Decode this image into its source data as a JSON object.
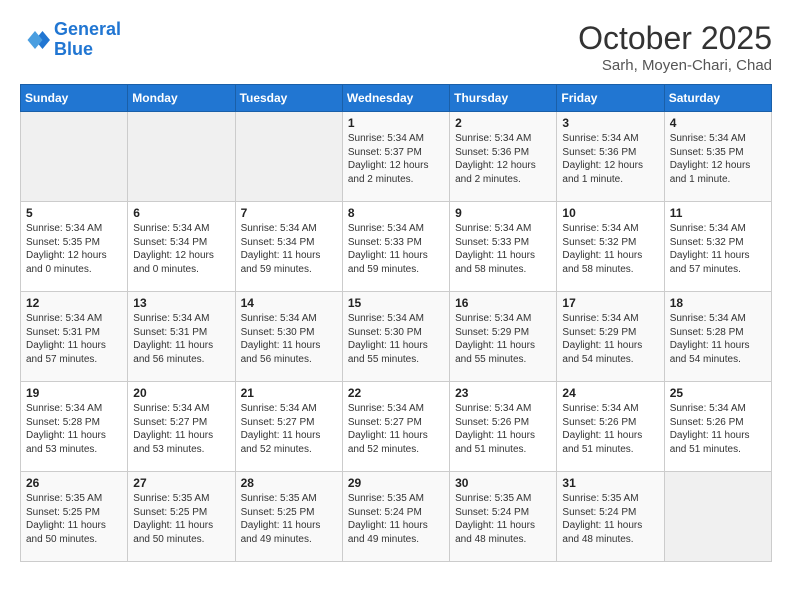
{
  "header": {
    "logo_line1": "General",
    "logo_line2": "Blue",
    "month": "October 2025",
    "location": "Sarh, Moyen-Chari, Chad"
  },
  "weekdays": [
    "Sunday",
    "Monday",
    "Tuesday",
    "Wednesday",
    "Thursday",
    "Friday",
    "Saturday"
  ],
  "weeks": [
    [
      {
        "day": "",
        "sunrise": "",
        "sunset": "",
        "daylight": "",
        "empty": true
      },
      {
        "day": "",
        "sunrise": "",
        "sunset": "",
        "daylight": "",
        "empty": true
      },
      {
        "day": "",
        "sunrise": "",
        "sunset": "",
        "daylight": "",
        "empty": true
      },
      {
        "day": "1",
        "sunrise": "Sunrise: 5:34 AM",
        "sunset": "Sunset: 5:37 PM",
        "daylight": "Daylight: 12 hours and 2 minutes."
      },
      {
        "day": "2",
        "sunrise": "Sunrise: 5:34 AM",
        "sunset": "Sunset: 5:36 PM",
        "daylight": "Daylight: 12 hours and 2 minutes."
      },
      {
        "day": "3",
        "sunrise": "Sunrise: 5:34 AM",
        "sunset": "Sunset: 5:36 PM",
        "daylight": "Daylight: 12 hours and 1 minute."
      },
      {
        "day": "4",
        "sunrise": "Sunrise: 5:34 AM",
        "sunset": "Sunset: 5:35 PM",
        "daylight": "Daylight: 12 hours and 1 minute."
      }
    ],
    [
      {
        "day": "5",
        "sunrise": "Sunrise: 5:34 AM",
        "sunset": "Sunset: 5:35 PM",
        "daylight": "Daylight: 12 hours and 0 minutes."
      },
      {
        "day": "6",
        "sunrise": "Sunrise: 5:34 AM",
        "sunset": "Sunset: 5:34 PM",
        "daylight": "Daylight: 12 hours and 0 minutes."
      },
      {
        "day": "7",
        "sunrise": "Sunrise: 5:34 AM",
        "sunset": "Sunset: 5:34 PM",
        "daylight": "Daylight: 11 hours and 59 minutes."
      },
      {
        "day": "8",
        "sunrise": "Sunrise: 5:34 AM",
        "sunset": "Sunset: 5:33 PM",
        "daylight": "Daylight: 11 hours and 59 minutes."
      },
      {
        "day": "9",
        "sunrise": "Sunrise: 5:34 AM",
        "sunset": "Sunset: 5:33 PM",
        "daylight": "Daylight: 11 hours and 58 minutes."
      },
      {
        "day": "10",
        "sunrise": "Sunrise: 5:34 AM",
        "sunset": "Sunset: 5:32 PM",
        "daylight": "Daylight: 11 hours and 58 minutes."
      },
      {
        "day": "11",
        "sunrise": "Sunrise: 5:34 AM",
        "sunset": "Sunset: 5:32 PM",
        "daylight": "Daylight: 11 hours and 57 minutes."
      }
    ],
    [
      {
        "day": "12",
        "sunrise": "Sunrise: 5:34 AM",
        "sunset": "Sunset: 5:31 PM",
        "daylight": "Daylight: 11 hours and 57 minutes."
      },
      {
        "day": "13",
        "sunrise": "Sunrise: 5:34 AM",
        "sunset": "Sunset: 5:31 PM",
        "daylight": "Daylight: 11 hours and 56 minutes."
      },
      {
        "day": "14",
        "sunrise": "Sunrise: 5:34 AM",
        "sunset": "Sunset: 5:30 PM",
        "daylight": "Daylight: 11 hours and 56 minutes."
      },
      {
        "day": "15",
        "sunrise": "Sunrise: 5:34 AM",
        "sunset": "Sunset: 5:30 PM",
        "daylight": "Daylight: 11 hours and 55 minutes."
      },
      {
        "day": "16",
        "sunrise": "Sunrise: 5:34 AM",
        "sunset": "Sunset: 5:29 PM",
        "daylight": "Daylight: 11 hours and 55 minutes."
      },
      {
        "day": "17",
        "sunrise": "Sunrise: 5:34 AM",
        "sunset": "Sunset: 5:29 PM",
        "daylight": "Daylight: 11 hours and 54 minutes."
      },
      {
        "day": "18",
        "sunrise": "Sunrise: 5:34 AM",
        "sunset": "Sunset: 5:28 PM",
        "daylight": "Daylight: 11 hours and 54 minutes."
      }
    ],
    [
      {
        "day": "19",
        "sunrise": "Sunrise: 5:34 AM",
        "sunset": "Sunset: 5:28 PM",
        "daylight": "Daylight: 11 hours and 53 minutes."
      },
      {
        "day": "20",
        "sunrise": "Sunrise: 5:34 AM",
        "sunset": "Sunset: 5:27 PM",
        "daylight": "Daylight: 11 hours and 53 minutes."
      },
      {
        "day": "21",
        "sunrise": "Sunrise: 5:34 AM",
        "sunset": "Sunset: 5:27 PM",
        "daylight": "Daylight: 11 hours and 52 minutes."
      },
      {
        "day": "22",
        "sunrise": "Sunrise: 5:34 AM",
        "sunset": "Sunset: 5:27 PM",
        "daylight": "Daylight: 11 hours and 52 minutes."
      },
      {
        "day": "23",
        "sunrise": "Sunrise: 5:34 AM",
        "sunset": "Sunset: 5:26 PM",
        "daylight": "Daylight: 11 hours and 51 minutes."
      },
      {
        "day": "24",
        "sunrise": "Sunrise: 5:34 AM",
        "sunset": "Sunset: 5:26 PM",
        "daylight": "Daylight: 11 hours and 51 minutes."
      },
      {
        "day": "25",
        "sunrise": "Sunrise: 5:34 AM",
        "sunset": "Sunset: 5:26 PM",
        "daylight": "Daylight: 11 hours and 51 minutes."
      }
    ],
    [
      {
        "day": "26",
        "sunrise": "Sunrise: 5:35 AM",
        "sunset": "Sunset: 5:25 PM",
        "daylight": "Daylight: 11 hours and 50 minutes."
      },
      {
        "day": "27",
        "sunrise": "Sunrise: 5:35 AM",
        "sunset": "Sunset: 5:25 PM",
        "daylight": "Daylight: 11 hours and 50 minutes."
      },
      {
        "day": "28",
        "sunrise": "Sunrise: 5:35 AM",
        "sunset": "Sunset: 5:25 PM",
        "daylight": "Daylight: 11 hours and 49 minutes."
      },
      {
        "day": "29",
        "sunrise": "Sunrise: 5:35 AM",
        "sunset": "Sunset: 5:24 PM",
        "daylight": "Daylight: 11 hours and 49 minutes."
      },
      {
        "day": "30",
        "sunrise": "Sunrise: 5:35 AM",
        "sunset": "Sunset: 5:24 PM",
        "daylight": "Daylight: 11 hours and 48 minutes."
      },
      {
        "day": "31",
        "sunrise": "Sunrise: 5:35 AM",
        "sunset": "Sunset: 5:24 PM",
        "daylight": "Daylight: 11 hours and 48 minutes."
      },
      {
        "day": "",
        "sunrise": "",
        "sunset": "",
        "daylight": "",
        "empty": true
      }
    ]
  ]
}
